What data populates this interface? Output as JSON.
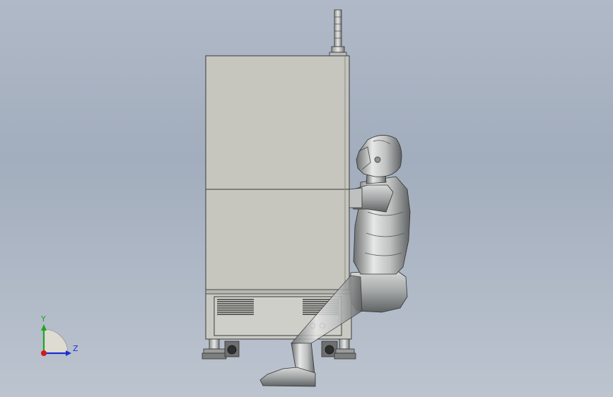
{
  "viewport": {
    "background_top": "#b0b9c7",
    "background_bottom": "#bcc4cf"
  },
  "machine": {
    "body_color": "#c6c6bf",
    "edge_color": "#3a3a3a",
    "vent_color": "#222222"
  },
  "operator": {
    "color_light": "#e3e4e3",
    "color_mid": "#a9abab",
    "color_dark": "#5d6060"
  },
  "triad": {
    "y_label": "Y",
    "z_label": "Z",
    "y_color": "#1fa61f",
    "z_color": "#1c2ed6",
    "x_color": "#d21a1a"
  }
}
